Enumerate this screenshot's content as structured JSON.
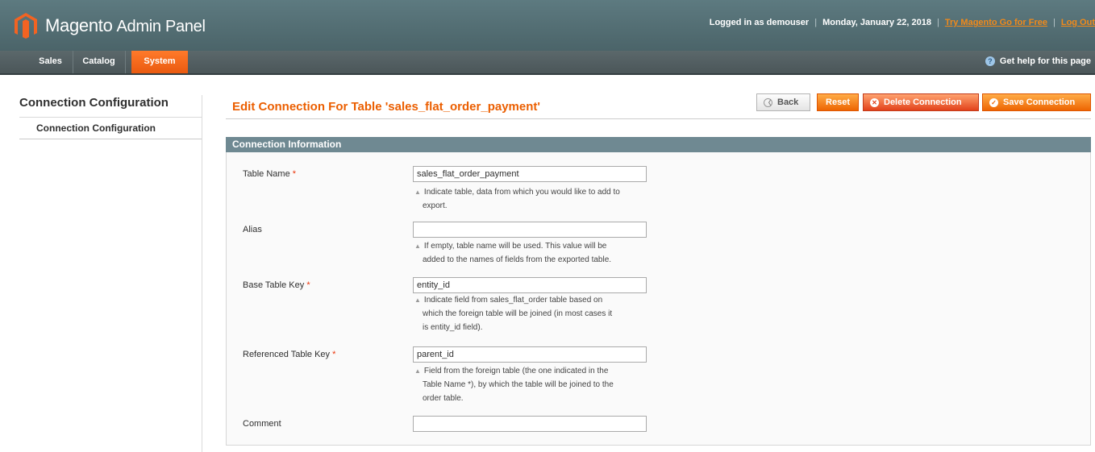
{
  "header": {
    "logo_brand": "Magento",
    "logo_suffix": "Admin Panel",
    "logged_in": "Logged in as demouser",
    "date": "Monday, January 22, 2018",
    "try_link": "Try Magento Go for Free",
    "logout": "Log Out"
  },
  "nav": {
    "items": [
      {
        "label": "Sales"
      },
      {
        "label": "Catalog"
      },
      {
        "label": "System",
        "active": true
      }
    ],
    "help": "Get help for this page"
  },
  "sidebar": {
    "title": "Connection Configuration",
    "items": [
      {
        "label": "Connection Configuration"
      }
    ]
  },
  "page": {
    "title": "Edit Connection For Table 'sales_flat_order_payment'",
    "buttons": {
      "back": "Back",
      "reset": "Reset",
      "delete": "Delete Connection",
      "save": "Save Connection"
    }
  },
  "section": {
    "title": "Connection Information",
    "fields": [
      {
        "label": "Table Name",
        "required": true,
        "value": "sales_flat_order_payment",
        "note_lines": [
          "Indicate table, data from which you would like to add to",
          "export."
        ]
      },
      {
        "label": "Alias",
        "required": false,
        "value": "",
        "note_lines": [
          "If empty, table name will be used. This value will be",
          "added to the names of fields from the exported table."
        ]
      },
      {
        "label": "Base Table Key",
        "required": true,
        "value": "entity_id",
        "note_lines": [
          "Indicate field from sales_flat_order table based on",
          "which the foreign table will be joined (in most cases it",
          "is entity_id field)."
        ]
      },
      {
        "label": "Referenced Table Key",
        "required": true,
        "value": "parent_id",
        "note_lines": [
          "Field from the foreign table (the one indicated in the",
          "Table Name *), by which the table will be joined to the",
          "order table."
        ]
      },
      {
        "label": "Comment",
        "required": false,
        "value": "",
        "note_lines": []
      }
    ]
  },
  "colors": {
    "accent_orange": "#eb5e00",
    "header_bg": "#4b6469",
    "section_header": "#6f8992",
    "required_star": "#eb340a"
  }
}
